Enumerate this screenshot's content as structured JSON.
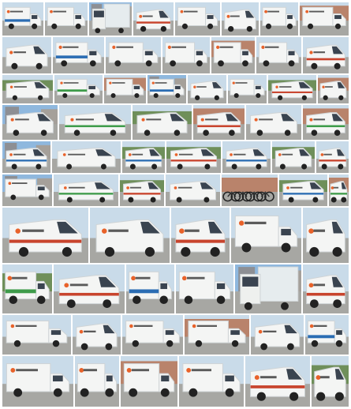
{
  "collage": {
    "palette": {
      "sky": "#c9dbe9",
      "sky_blue": "#8fb8de",
      "trees": "#6f8f5a",
      "ground": "#a7a7a3",
      "brick": "#b9836b",
      "van_white": "#f4f5f4",
      "van_shadow": "#cfd4d6",
      "window": "#3a4450",
      "wheel": "#222222",
      "logo_orange": "#e8622a",
      "stripe_red": "#c8442d",
      "stripe_blue": "#2b6db3",
      "stripe_green": "#3e9b4a"
    },
    "tiles": [
      {
        "scene": "street",
        "vehicle": "box-truck",
        "logo": true,
        "stripe": "blue"
      },
      {
        "scene": "street",
        "vehicle": "box-truck",
        "logo": true,
        "stripe": "none"
      },
      {
        "scene": "city",
        "vehicle": "truck",
        "logo": false,
        "stripe": "none"
      },
      {
        "scene": "street",
        "vehicle": "van",
        "logo": true,
        "stripe": "red"
      },
      {
        "scene": "street",
        "vehicle": "box-truck",
        "logo": true,
        "stripe": "none"
      },
      {
        "scene": "street",
        "vehicle": "van",
        "logo": true,
        "stripe": "none"
      },
      {
        "scene": "street",
        "vehicle": "box-truck",
        "logo": true,
        "stripe": "none"
      },
      {
        "scene": "depot",
        "vehicle": "box-truck",
        "logo": true,
        "stripe": "none"
      },
      {
        "scene": "street",
        "vehicle": "van",
        "logo": true,
        "stripe": "none"
      },
      {
        "scene": "street",
        "vehicle": "box-truck",
        "logo": true,
        "stripe": "blue"
      },
      {
        "scene": "street",
        "vehicle": "box-truck",
        "logo": true,
        "stripe": "none"
      },
      {
        "scene": "street",
        "vehicle": "box-truck",
        "logo": true,
        "stripe": "none"
      },
      {
        "scene": "depot",
        "vehicle": "box-truck",
        "logo": true,
        "stripe": "none"
      },
      {
        "scene": "street",
        "vehicle": "box-truck",
        "logo": true,
        "stripe": "none"
      },
      {
        "scene": "street",
        "vehicle": "van",
        "logo": true,
        "stripe": "red"
      },
      {
        "scene": "trees",
        "vehicle": "van",
        "logo": true,
        "stripe": "none"
      },
      {
        "scene": "street",
        "vehicle": "box-truck",
        "logo": true,
        "stripe": "multi"
      },
      {
        "scene": "depot",
        "vehicle": "box-truck",
        "logo": true,
        "stripe": "none"
      },
      {
        "scene": "city",
        "vehicle": "box-truck",
        "logo": true,
        "stripe": "blue"
      },
      {
        "scene": "street",
        "vehicle": "van",
        "logo": true,
        "stripe": "none"
      },
      {
        "scene": "street",
        "vehicle": "box-truck",
        "logo": true,
        "stripe": "none"
      },
      {
        "scene": "trees",
        "vehicle": "van",
        "logo": true,
        "stripe": "red"
      },
      {
        "scene": "depot",
        "vehicle": "van",
        "logo": true,
        "stripe": "none"
      },
      {
        "scene": "city",
        "vehicle": "van",
        "logo": true,
        "stripe": "none"
      },
      {
        "scene": "street",
        "vehicle": "van",
        "logo": true,
        "stripe": "multi"
      },
      {
        "scene": "trees",
        "vehicle": "van",
        "logo": true,
        "stripe": "none"
      },
      {
        "scene": "depot",
        "vehicle": "van",
        "logo": true,
        "stripe": "red"
      },
      {
        "scene": "street",
        "vehicle": "van",
        "logo": true,
        "stripe": "none"
      },
      {
        "scene": "depot",
        "vehicle": "van",
        "logo": true,
        "stripe": "multi"
      },
      {
        "scene": "city",
        "vehicle": "van",
        "logo": true,
        "stripe": "blue"
      },
      {
        "scene": "street",
        "vehicle": "van",
        "logo": true,
        "stripe": "none"
      },
      {
        "scene": "trees",
        "vehicle": "van",
        "logo": true,
        "stripe": "blue"
      },
      {
        "scene": "trees",
        "vehicle": "van",
        "logo": true,
        "stripe": "red"
      },
      {
        "scene": "street",
        "vehicle": "van",
        "logo": true,
        "stripe": "blue"
      },
      {
        "scene": "trees",
        "vehicle": "van",
        "logo": true,
        "stripe": "none"
      },
      {
        "scene": "street",
        "vehicle": "van",
        "logo": true,
        "stripe": "red"
      },
      {
        "scene": "city",
        "vehicle": "box-truck",
        "logo": true,
        "stripe": "none"
      },
      {
        "scene": "street",
        "vehicle": "van",
        "logo": true,
        "stripe": "multi"
      },
      {
        "scene": "trees",
        "vehicle": "van",
        "logo": true,
        "stripe": "red"
      },
      {
        "scene": "street",
        "vehicle": "van",
        "logo": true,
        "stripe": "none"
      },
      {
        "scene": "depot",
        "vehicle": "bicycles",
        "logo": false,
        "stripe": "none"
      },
      {
        "scene": "trees",
        "vehicle": "van",
        "logo": true,
        "stripe": "blue"
      },
      {
        "scene": "depot",
        "vehicle": "van",
        "logo": true,
        "stripe": "multi"
      },
      {
        "scene": "street",
        "vehicle": "van",
        "logo": true,
        "stripe": "red"
      },
      {
        "scene": "street",
        "vehicle": "van",
        "logo": true,
        "stripe": "none"
      },
      {
        "scene": "street",
        "vehicle": "van",
        "logo": true,
        "stripe": "red"
      },
      {
        "scene": "street",
        "vehicle": "box-truck",
        "logo": true,
        "stripe": "none"
      },
      {
        "scene": "street",
        "vehicle": "van",
        "logo": true,
        "stripe": "none"
      },
      {
        "scene": "trees",
        "vehicle": "box-truck",
        "logo": true,
        "stripe": "multi"
      },
      {
        "scene": "street",
        "vehicle": "van",
        "logo": true,
        "stripe": "red"
      }
    ]
  }
}
